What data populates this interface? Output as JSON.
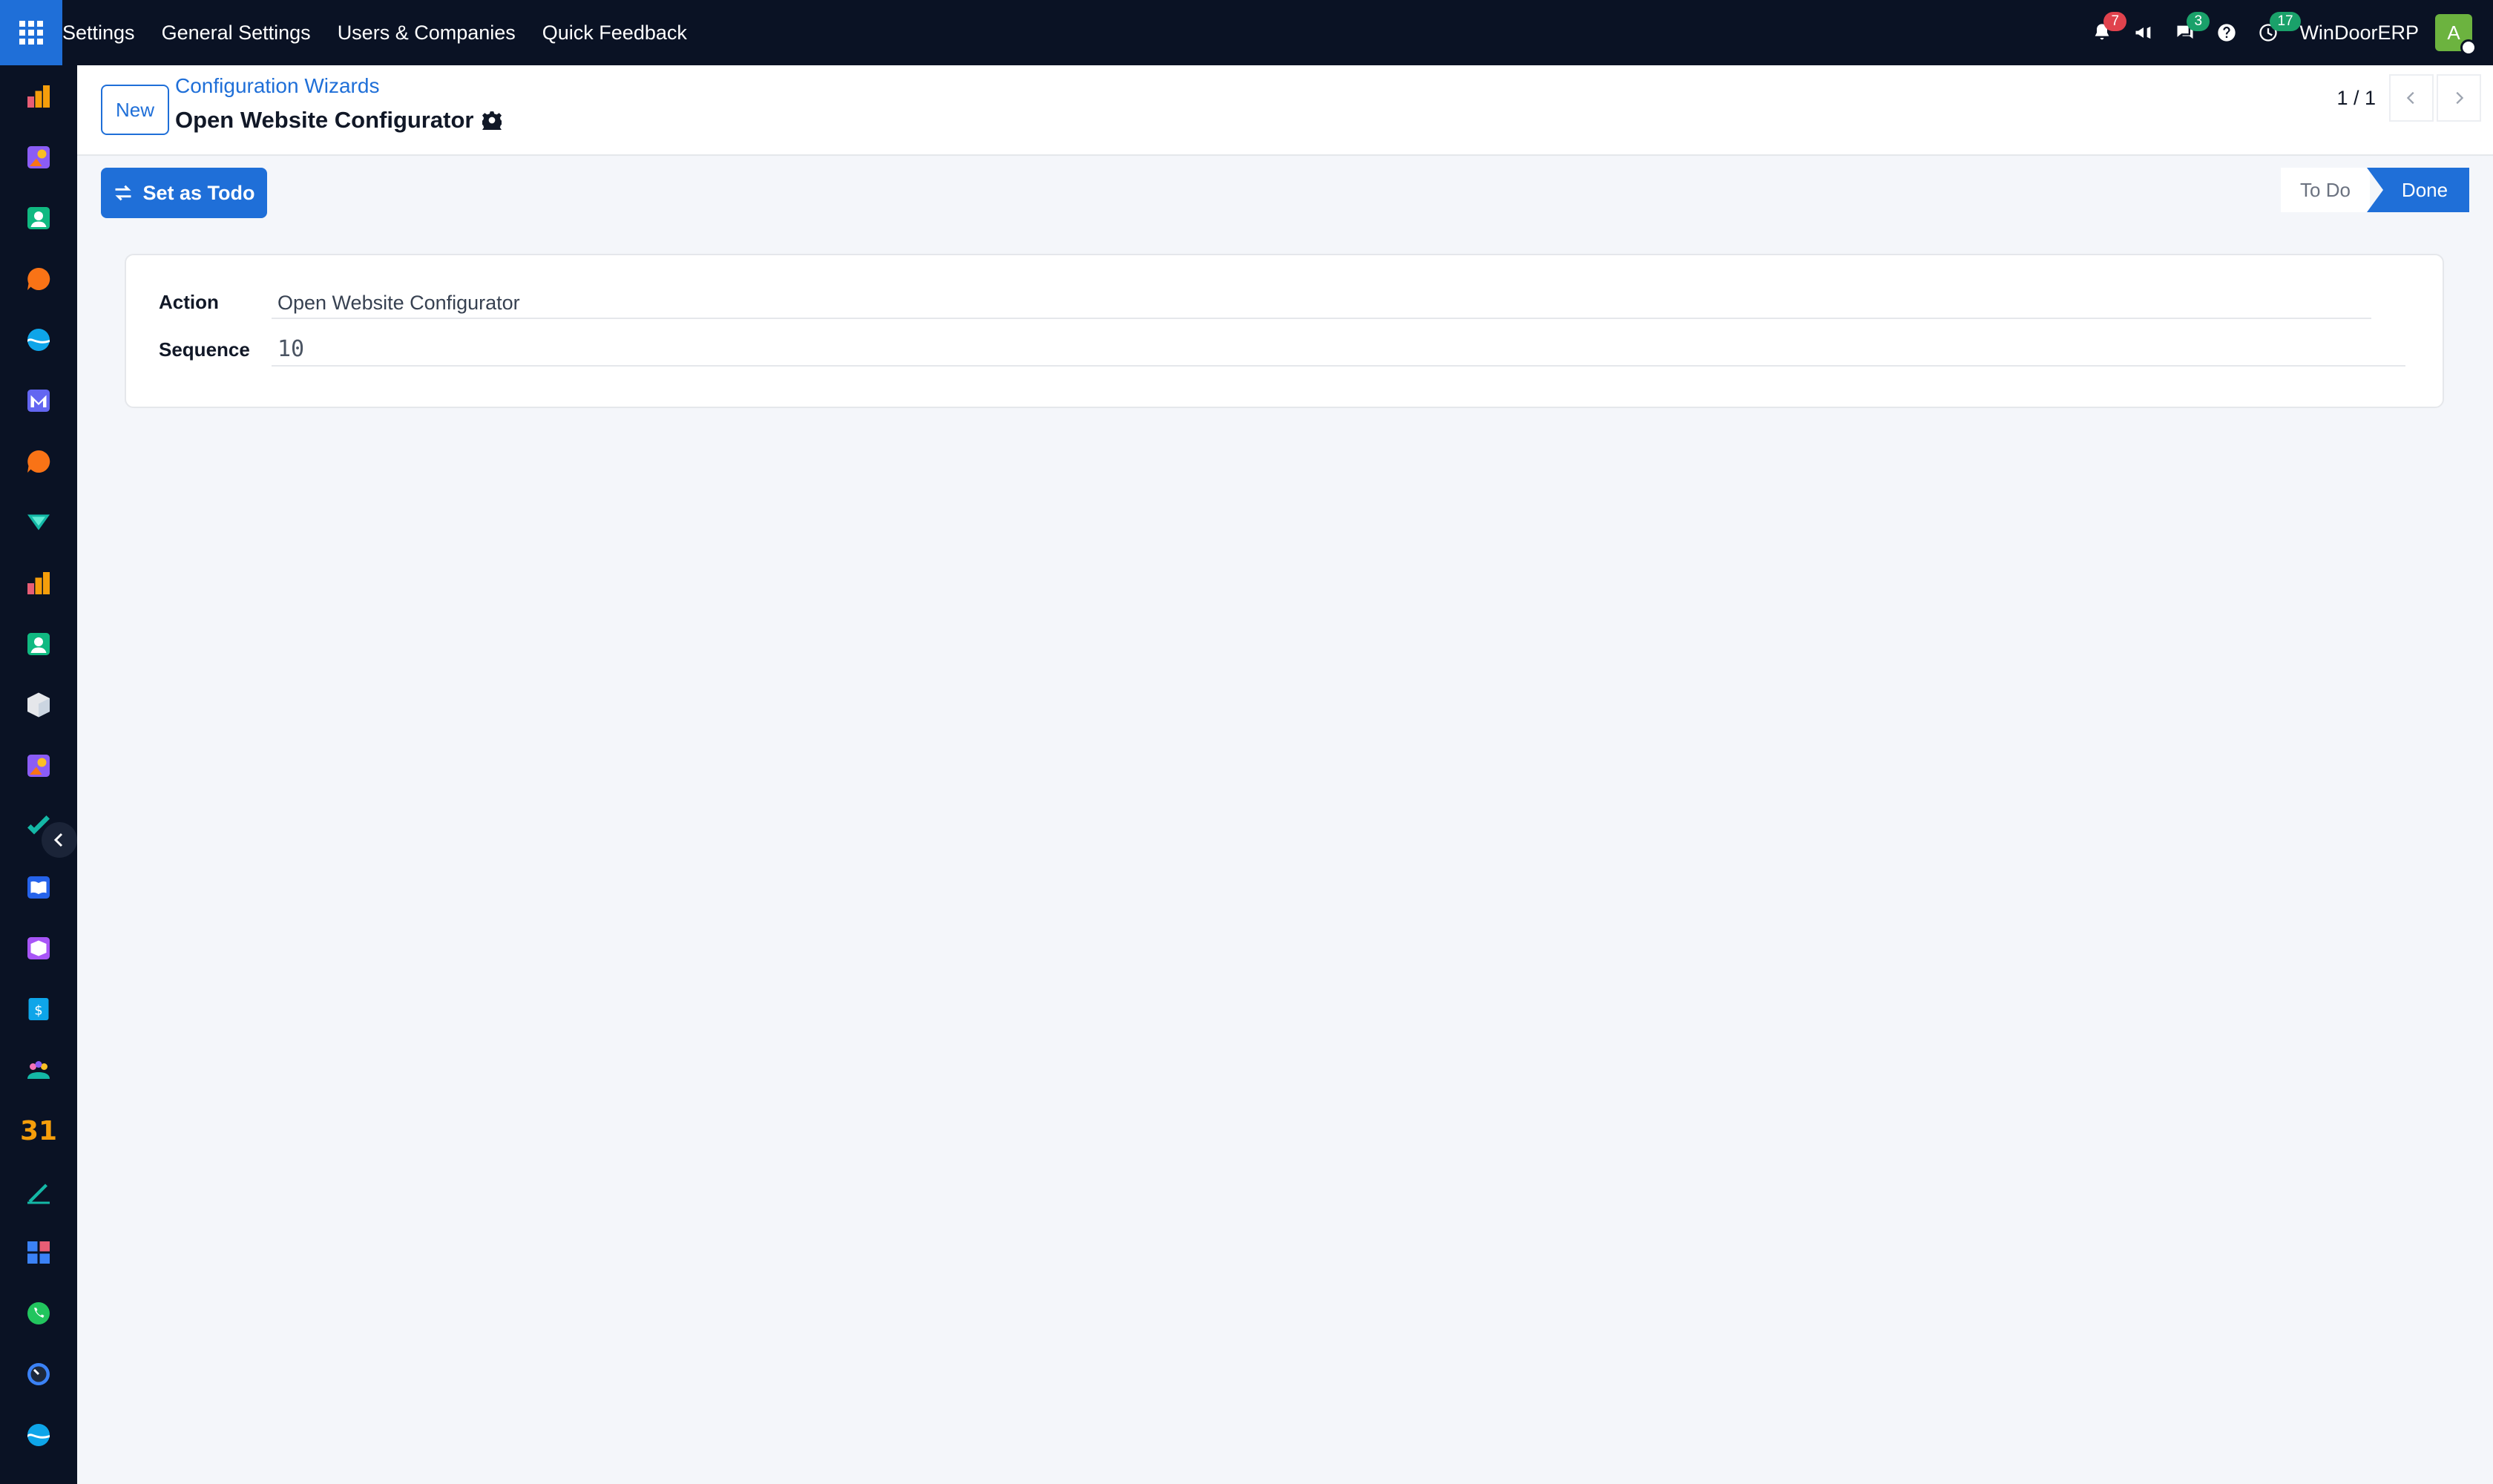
{
  "navbar": {
    "app_name": "Settings",
    "menu": [
      "General Settings",
      "Users & Companies",
      "Quick Feedback"
    ],
    "notifications_count": "7",
    "messages_count": "3",
    "activities_count": "17",
    "company": "WinDoorERP",
    "avatar_letter": "A"
  },
  "sidebar": {
    "apps": [
      "dashboard-icon",
      "photo-icon",
      "contacts-icon",
      "discuss-icon",
      "wave-icon",
      "mail-icon",
      "livechat-icon",
      "survey-icon",
      "reports-icon",
      "employees-icon",
      "inventory-icon",
      "image-icon",
      "project-icon",
      "knowledge-icon",
      "product-icon",
      "invoicing-icon",
      "crm-icon",
      "calendar-icon",
      "sign-icon",
      "apps-icon",
      "whatsapp-icon",
      "timer-icon",
      "website-icon"
    ],
    "calendar_day": "31"
  },
  "control_panel": {
    "new_label": "New",
    "breadcrumb": "Configuration Wizards",
    "record_title": "Open Website Configurator",
    "pager_value": "1 / 1"
  },
  "statusbar": {
    "action_label": "Set as Todo",
    "states": [
      "To Do",
      "Done"
    ],
    "active_state": "Done"
  },
  "form": {
    "action_label": "Action",
    "action_value": "Open Website Configurator",
    "sequence_label": "Sequence",
    "sequence_value": "10"
  },
  "colors": {
    "primary": "#1f6fd8",
    "navbar_bg": "#0a1224",
    "page_bg": "#f4f6fa",
    "badge_red": "#e0424d",
    "badge_green": "#1aa16a"
  }
}
